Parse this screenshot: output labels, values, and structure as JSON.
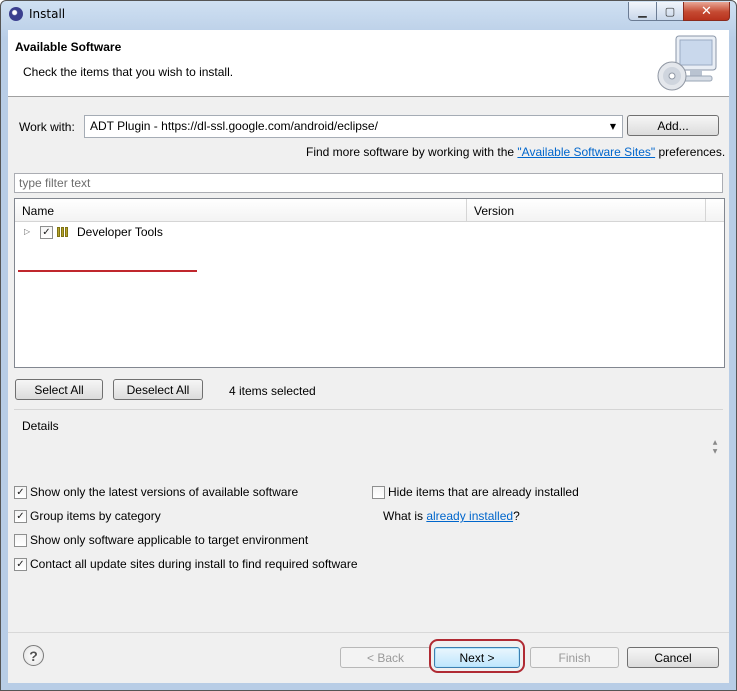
{
  "window": {
    "title": "Install"
  },
  "header": {
    "title": "Available Software",
    "description": "Check the items that you wish to install."
  },
  "work_with": {
    "label": "Work with:",
    "value": "ADT Plugin - https://dl-ssl.google.com/android/eclipse/",
    "add_button": "Add...",
    "find_more_prefix": "Find more software by working with the ",
    "find_more_link": "\"Available Software Sites\"",
    "find_more_suffix": " preferences."
  },
  "filter": {
    "placeholder": "type filter text"
  },
  "tree": {
    "columns": [
      "Name",
      "Version"
    ],
    "rows": [
      {
        "label": "Developer Tools",
        "version": "",
        "checked": true,
        "icon": "package-icon"
      }
    ]
  },
  "selection": {
    "select_all": "Select All",
    "deselect_all": "Deselect All",
    "status": "4 items selected"
  },
  "details": {
    "label": "Details"
  },
  "options": {
    "latest_versions": {
      "label": "Show only the latest versions of available software",
      "checked": true
    },
    "group_by_category": {
      "label": "Group items by category",
      "checked": true
    },
    "applicable_only": {
      "label": "Show only software applicable to target environment",
      "checked": false
    },
    "contact_sites": {
      "label": "Contact all update sites during install to find required software",
      "checked": true
    },
    "hide_installed": {
      "label": "Hide items that are already installed",
      "checked": false
    },
    "what_is_prefix": "What is ",
    "what_is_link": "already installed",
    "what_is_suffix": "?"
  },
  "footer": {
    "back": "< Back",
    "next": "Next >",
    "finish": "Finish",
    "cancel": "Cancel",
    "help_glyph": "?"
  },
  "colors": {
    "link": "#0066cc",
    "annotation_red": "#c0272d"
  }
}
